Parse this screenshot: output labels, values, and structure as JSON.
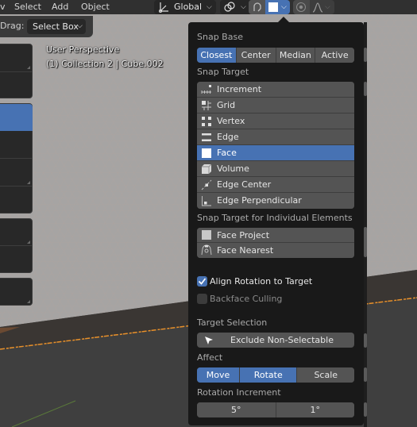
{
  "header": {
    "menu": [
      "Select",
      "Add",
      "Object"
    ],
    "orientation_label": "Global",
    "drag_label": "Drag:",
    "drag_value": "Select Box",
    "icons": {
      "orientation": "transform-orientation-icon",
      "pivot": "pivot-link-icon",
      "snap": "magnet-snap-icon",
      "snap_target": "face-square-icon",
      "proportional": "proportional-edit-icon",
      "falloff": "falloff-curve-icon"
    }
  },
  "viewport": {
    "perspective": "User Perspective",
    "collection": "(1) Collection 2 | Cube.002"
  },
  "snap_popup": {
    "snap_base_label": "Snap Base",
    "snap_base_options": [
      {
        "label": "Closest",
        "active": true
      },
      {
        "label": "Center",
        "active": false
      },
      {
        "label": "Median",
        "active": false
      },
      {
        "label": "Active",
        "active": false
      }
    ],
    "snap_target_label": "Snap Target",
    "snap_targets": [
      {
        "label": "Increment",
        "icon": "increment-icon",
        "active": false
      },
      {
        "label": "Grid",
        "icon": "grid-icon",
        "active": false
      },
      {
        "label": "Vertex",
        "icon": "vertex-icon",
        "active": false
      },
      {
        "label": "Edge",
        "icon": "edge-icon",
        "active": false
      },
      {
        "label": "Face",
        "icon": "face-icon",
        "active": true
      },
      {
        "label": "Volume",
        "icon": "volume-icon",
        "active": false
      },
      {
        "label": "Edge Center",
        "icon": "edge-center-icon",
        "active": false
      },
      {
        "label": "Edge Perpendicular",
        "icon": "edge-perpendicular-icon",
        "active": false
      }
    ],
    "individual_label": "Snap Target for Individual Elements",
    "individual_targets": [
      {
        "label": "Face Project",
        "icon": "face-project-icon",
        "active": false
      },
      {
        "label": "Face Nearest",
        "icon": "face-nearest-icon",
        "active": false
      }
    ],
    "align_rotation": {
      "label": "Align Rotation to Target",
      "checked": true
    },
    "backface_culling": {
      "label": "Backface Culling",
      "checked": false
    },
    "target_selection_label": "Target Selection",
    "exclude_button": "Exclude Non-Selectable",
    "affect_label": "Affect",
    "affect_options": [
      {
        "label": "Move",
        "active": true
      },
      {
        "label": "Rotate",
        "active": true
      },
      {
        "label": "Scale",
        "active": false
      }
    ],
    "rotation_increment_label": "Rotation Increment",
    "rotation_increments": [
      "5°",
      "1°"
    ]
  },
  "colors": {
    "accent": "#4772b3",
    "popup_bg": "#191919",
    "button_bg": "#545454",
    "selection_outline": "#e8902a"
  }
}
